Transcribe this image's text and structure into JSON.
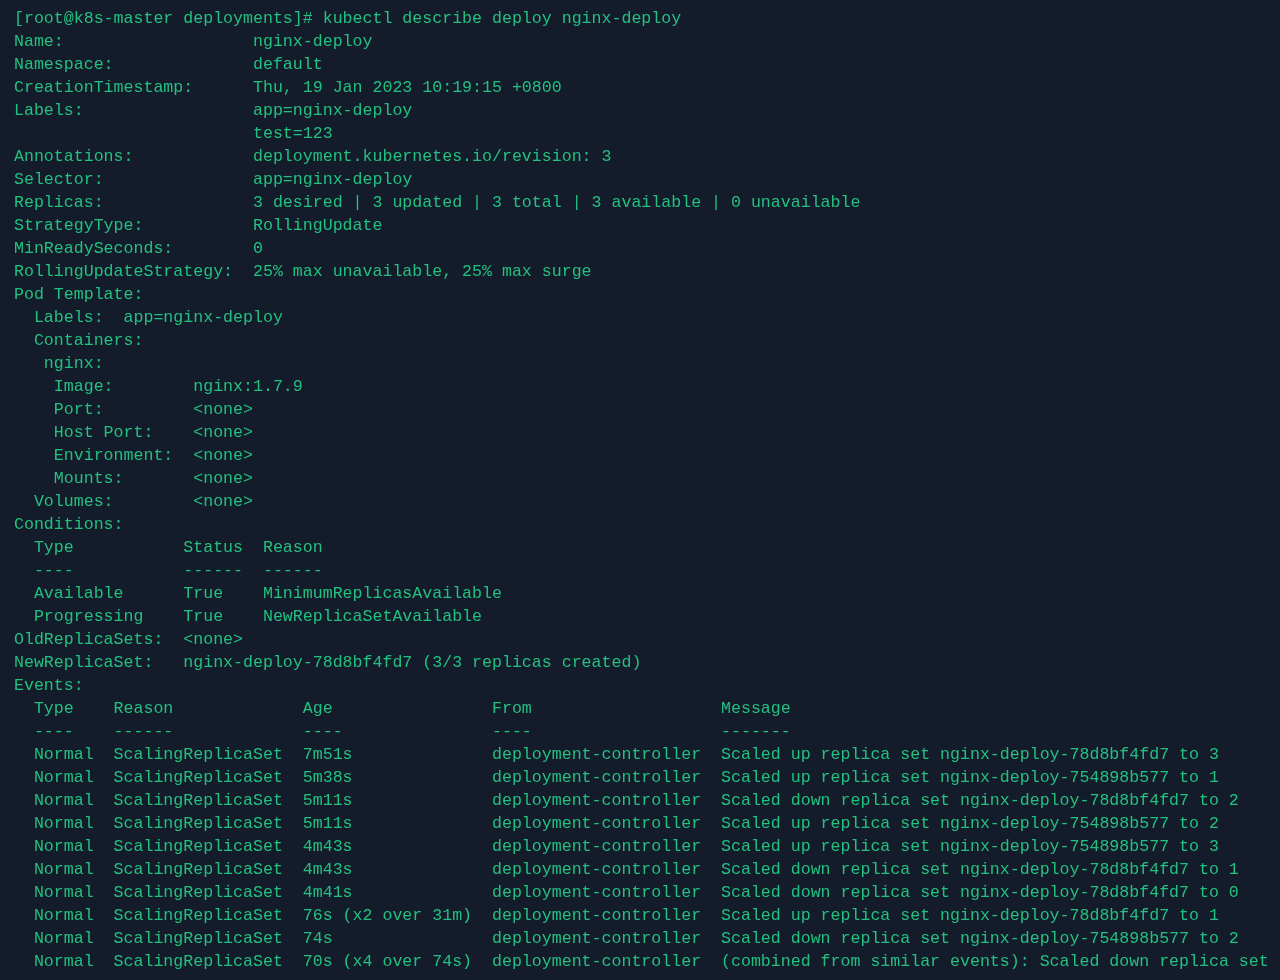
{
  "terminal": {
    "lines": [
      "[root@k8s-master deployments]# kubectl describe deploy nginx-deploy",
      "Name:                   nginx-deploy",
      "Namespace:              default",
      "CreationTimestamp:      Thu, 19 Jan 2023 10:19:15 +0800",
      "Labels:                 app=nginx-deploy",
      "                        test=123",
      "Annotations:            deployment.kubernetes.io/revision: 3",
      "Selector:               app=nginx-deploy",
      "Replicas:               3 desired | 3 updated | 3 total | 3 available | 0 unavailable",
      "StrategyType:           RollingUpdate",
      "MinReadySeconds:        0",
      "RollingUpdateStrategy:  25% max unavailable, 25% max surge",
      "Pod Template:",
      "  Labels:  app=nginx-deploy",
      "  Containers:",
      "   nginx:",
      "    Image:        nginx:1.7.9",
      "    Port:         <none>",
      "    Host Port:    <none>",
      "    Environment:  <none>",
      "    Mounts:       <none>",
      "  Volumes:        <none>",
      "Conditions:",
      "  Type           Status  Reason",
      "  ----           ------  ------",
      "  Available      True    MinimumReplicasAvailable",
      "  Progressing    True    NewReplicaSetAvailable",
      "OldReplicaSets:  <none>",
      "NewReplicaSet:   nginx-deploy-78d8bf4fd7 (3/3 replicas created)",
      "Events:",
      "  Type    Reason             Age                From                   Message",
      "  ----    ------             ----               ----                   -------",
      "  Normal  ScalingReplicaSet  7m51s              deployment-controller  Scaled up replica set nginx-deploy-78d8bf4fd7 to 3",
      "  Normal  ScalingReplicaSet  5m38s              deployment-controller  Scaled up replica set nginx-deploy-754898b577 to 1",
      "  Normal  ScalingReplicaSet  5m11s              deployment-controller  Scaled down replica set nginx-deploy-78d8bf4fd7 to 2",
      "  Normal  ScalingReplicaSet  5m11s              deployment-controller  Scaled up replica set nginx-deploy-754898b577 to 2",
      "  Normal  ScalingReplicaSet  4m43s              deployment-controller  Scaled up replica set nginx-deploy-754898b577 to 3",
      "  Normal  ScalingReplicaSet  4m43s              deployment-controller  Scaled down replica set nginx-deploy-78d8bf4fd7 to 1",
      "  Normal  ScalingReplicaSet  4m41s              deployment-controller  Scaled down replica set nginx-deploy-78d8bf4fd7 to 0",
      "  Normal  ScalingReplicaSet  76s (x2 over 31m)  deployment-controller  Scaled up replica set nginx-deploy-78d8bf4fd7 to 1",
      "  Normal  ScalingReplicaSet  74s                deployment-controller  Scaled down replica set nginx-deploy-754898b577 to 2",
      "  Normal  ScalingReplicaSet  70s (x4 over 74s)  deployment-controller  (combined from similar events): Scaled down replica set"
    ]
  }
}
